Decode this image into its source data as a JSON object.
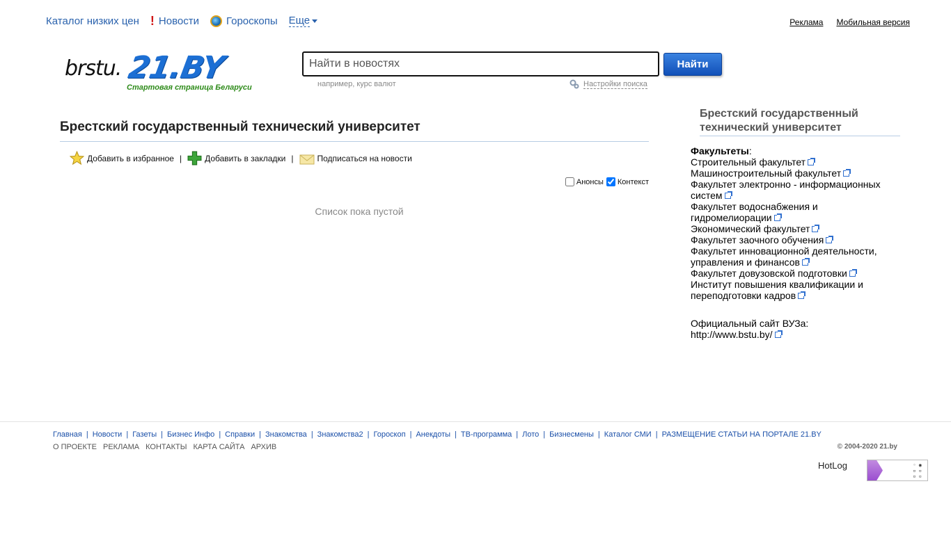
{
  "topnav": {
    "catalog": "Каталог низких цен",
    "news": "Новости",
    "horoscopes": "Гороскопы",
    "more": "Еще"
  },
  "toplinks": {
    "ads": "Реклама",
    "mobile": "Мобильная версия"
  },
  "logo": {
    "prefix": "brstu.",
    "brand": "21.BY",
    "tagline": "Стартовая страница Беларуси"
  },
  "search": {
    "placeholder": "Найти в новостях",
    "button": "Найти",
    "hint": "например, курс валют",
    "settings": "Настройки поиска"
  },
  "main": {
    "title": "Брестский государственный технический университет",
    "actions": {
      "favorites": "Добавить в избранное",
      "bookmarks": "Добавить в закладки",
      "subscribe": "Подписаться на новости"
    },
    "filters": {
      "announcements": "Анонсы",
      "announcements_checked": false,
      "context": "Контекст",
      "context_checked": true
    },
    "empty": "Список пока пустой"
  },
  "sidebar": {
    "title": "Брестский государственный технический университет",
    "faculties_header": "Факультеты",
    "faculties": [
      "Строительный факультет",
      "Машиностроительный факультет",
      "Факультет электронно - информационных систем",
      "Факультет водоснабжения и гидромелиорации",
      "Экономический факультет",
      "Факультет заочного обучения",
      "Факультет инновационной деятельности, управления и финансов",
      "Факультет довузовской подготовки",
      "Институт повышения квалификации и переподготовки кадров"
    ],
    "official_label": "Официальный сайт ВУЗа:",
    "official_url": "http://www.bstu.by/"
  },
  "footer": {
    "nav": [
      "Главная",
      "Новости",
      "Газеты",
      "Бизнес Инфо",
      "Справки",
      "Знакомства",
      "Знакомства2",
      "Гороскоп",
      "Анекдоты",
      "ТВ-программа",
      "Лото",
      "Бизнесмены",
      "Каталог СМИ",
      "РАЗМЕЩЕНИЕ СТАТЬИ НА ПОРТАЛЕ 21.BY"
    ],
    "nav2": [
      "О ПРОЕКТЕ",
      "РЕКЛАМА",
      "КОНТАКТЫ",
      "КАРТА САЙТА",
      "АРХИВ"
    ],
    "copyright": "© 2004-2020 21.by",
    "hotlog": "HotLog"
  }
}
